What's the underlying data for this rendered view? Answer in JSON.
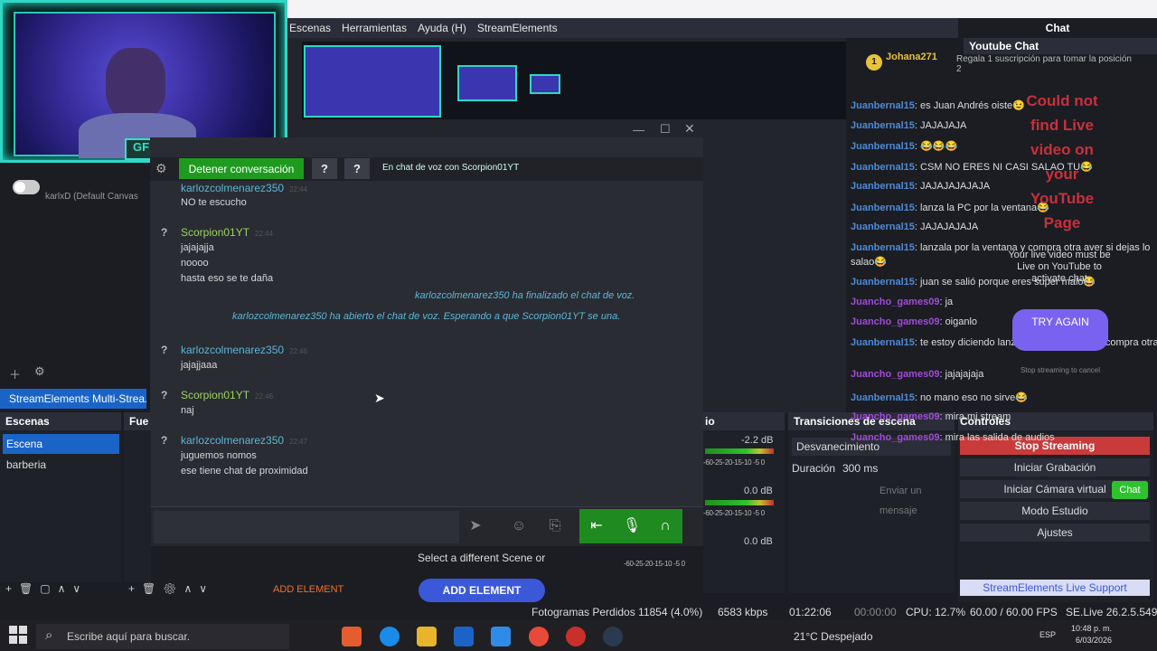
{
  "menu": {
    "items": [
      "Escenas",
      "Herramientas",
      "Ayuda (H)",
      "StreamElements"
    ]
  },
  "webcam": {
    "badge": "GF"
  },
  "voice_chat": {
    "stop_label": "Detener conversación",
    "help1": "?",
    "help2": "?",
    "status": "En chat de voz con Scorpion01YT",
    "messages": [
      {
        "user": "karlozcolmenarez350",
        "time": "22:44",
        "lines": [
          "NO te escucho"
        ],
        "color": "blue",
        "top": 0
      },
      {
        "user": "Scorpion01YT",
        "time": "22:44",
        "lines": [
          "jajajajja",
          "noooo",
          "hasta eso se te daña"
        ],
        "color": "green"
      },
      {
        "user": "karlozcolmenarez350",
        "time": "22:46",
        "lines": [
          "jajajjaaa"
        ],
        "color": "blue"
      },
      {
        "user": "Scorpion01YT",
        "time": "22:46",
        "lines": [
          "naj"
        ],
        "color": "green"
      },
      {
        "user": "karlozcolmenarez350",
        "time": "22:47",
        "lines": [
          "juguemos nomos",
          "ese tiene chat de proximidad"
        ],
        "color": "blue"
      }
    ],
    "system1": "karlozcolmenarez350 ha finalizado el chat de voz.",
    "system2": "karlozcolmenarez350 ha abierto el chat de voz. Esperando a que Scorpion01YT se una."
  },
  "left": {
    "canvas": "karlxD (Default Canvas",
    "se_tab": "StreamElements Multi-Strea..."
  },
  "scenes": {
    "header": "Escenas",
    "items": [
      "Escena",
      "barberia"
    ],
    "selected": 0
  },
  "sources": {
    "header": "Fue"
  },
  "add_element": {
    "left": "ADD ELEMENT",
    "button": "ADD ELEMENT",
    "prompt": "Select a different Scene or"
  },
  "mixer": {
    "header": "io",
    "db1": "-2.2 dB",
    "db2": "0.0 dB",
    "db3": "0.0 dB",
    "scale": "-60-25-20-15-10 -5 0"
  },
  "transitions": {
    "header": "Transiciones de escena",
    "selected": "Desvanecimiento",
    "duration_label": "Duración",
    "duration_value": "300 ms"
  },
  "controls": {
    "header": "Controles",
    "stop_stream": "Stop Streaming",
    "start_record": "Iniciar Grabación",
    "virtual_cam": "Iniciar Cámara virtual",
    "studio": "Modo Estudio",
    "settings": "Ajustes",
    "live_support": "StreamElements Live Support"
  },
  "chat": {
    "panel_title": "Chat",
    "youtube_title": "Youtube Chat",
    "donor": "Johana271",
    "donor_count": "1",
    "donor_text": "Regala 1 suscripción para tomar la posición 2",
    "messages": [
      {
        "user": "Juanbernal15",
        "text": "es Juan Andrés oiste😉"
      },
      {
        "user": "Juanbernal15",
        "text": "JAJAJAJA"
      },
      {
        "user": "Juanbernal15",
        "text": "😂😂😂"
      },
      {
        "user": "Juanbernal15",
        "text": "CSM NO ERES NI CASI SALAO TU😂"
      },
      {
        "user": "Juanbernal15",
        "text": "JAJAJAJAJAJA"
      },
      {
        "user": "Juanbernal15",
        "text": "lanza la PC por la ventana😂"
      },
      {
        "user": "Juanbernal15",
        "text": "JAJAJAJAJA"
      },
      {
        "user": "Juanbernal15",
        "text": "lanzala por la ventana y compra otra aver si dejas lo"
      },
      {
        "user": "",
        "text": "salao😂"
      },
      {
        "user": "Juanbernal15",
        "text": "juan se salió porque eres super malo😂"
      },
      {
        "user": "Juancho_games09",
        "text": "ja",
        "purple": true
      },
      {
        "user": "Juancho_games09",
        "text": "oiganlo",
        "purple": true
      },
      {
        "user": "Juanbernal15",
        "text": "te estoy diciendo lanzala por la ventana y compra otra"
      },
      {
        "user": "Juancho_games09",
        "text": "jajajajaja",
        "purple": true
      },
      {
        "user": "Juanbernal15",
        "text": "no mano eso no sirve😂"
      },
      {
        "user": "Juancho_games09",
        "text": "mira mi stream",
        "purple": true
      },
      {
        "user": "Juancho_games09",
        "text": "mira las salida de audios",
        "purple": true
      }
    ],
    "error": "Could not find Live video on your YouTube Page",
    "live_note": "Your live video must be Live on YouTube to activate chat",
    "try_again": "TRY AGAIN",
    "stop_note": "Stop streaming to cancel",
    "send_placeholder": "Enviar un mensaje",
    "chat_button": "Chat"
  },
  "status": {
    "dropped": "Fotogramas Perdidos 11854 (4.0%)",
    "bitrate": "6583 kbps",
    "live_time": "01:22:06",
    "rec_time": "00:00:00",
    "cpu": "CPU: 12.7%",
    "fps": "60.00 / 60.00 FPS",
    "version": "SE.Live 26.2.5.549"
  },
  "taskbar": {
    "search": "Escribe aquí para buscar.",
    "weather": "21°C  Despejado",
    "lang": "ESP",
    "time": "10:48 p. m.",
    "date": "6/03/2026"
  },
  "colors": {
    "accent": "#1a64c8",
    "green": "#1e9b1e",
    "red": "#c93a3a"
  }
}
